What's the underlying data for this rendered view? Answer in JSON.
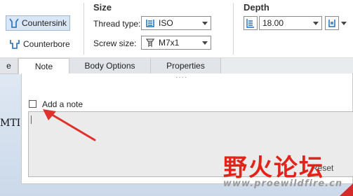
{
  "ribbon": {
    "type_buttons": [
      {
        "label": "Countersink",
        "icon": "countersink-icon",
        "selected": true
      },
      {
        "label": "Counterbore",
        "icon": "counterbore-icon",
        "selected": false
      }
    ],
    "size": {
      "title": "Size",
      "thread_type_label": "Thread type:",
      "thread_type_value": "ISO",
      "screw_size_label": "Screw size:",
      "screw_size_value": "M7x1"
    },
    "depth": {
      "title": "Depth",
      "value": "18.00"
    }
  },
  "tabs": [
    {
      "label": "e",
      "active": false
    },
    {
      "label": "Note",
      "active": true
    },
    {
      "label": "Body Options",
      "active": false
    },
    {
      "label": "Properties",
      "active": false
    }
  ],
  "note_panel": {
    "checkbox_label": "Add a note",
    "checked": false,
    "note_text": "",
    "reset_label": "Reset"
  },
  "background": {
    "partial_text": "MTI"
  },
  "watermark": {
    "chinese": "野火论坛",
    "url": "www.proewildfire.cn"
  },
  "colors": {
    "accent": "#1f6fc1",
    "selected_bg": "#d9e6f5",
    "arrow": "#e0322a",
    "watermark_red": "#e2231a"
  }
}
